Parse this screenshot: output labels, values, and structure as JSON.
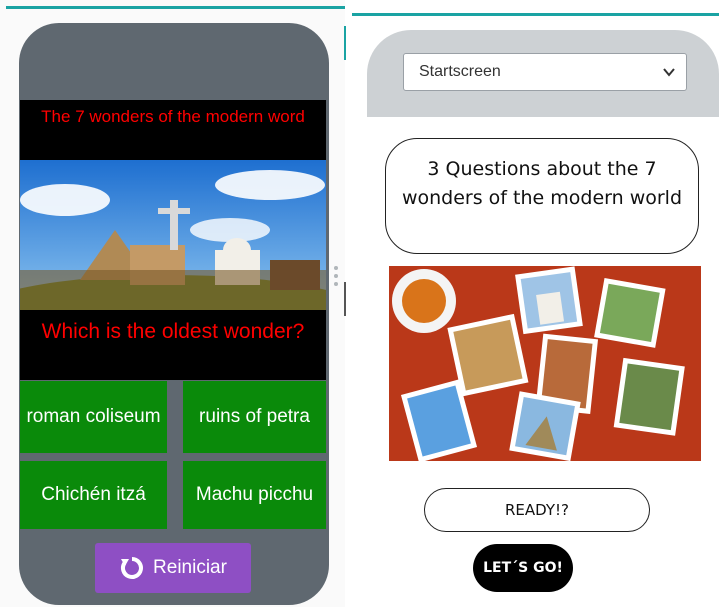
{
  "left_app": {
    "quiz_title": "The 7 wonders of the modern word",
    "hero_image_icon": "wonders-collage-image",
    "question": "Which is the oldest wonder?",
    "answers": [
      "roman coliseum",
      "ruins of petra",
      "Chichén itzá",
      "Machu picchu"
    ],
    "restart_label": "Reiniciar",
    "restart_icon": "refresh-icon",
    "colors": {
      "title_text": "#ff0000",
      "answer_bg": "#0a8a0a",
      "restart_bg": "#8e4fc4",
      "frame": "#5f6870"
    }
  },
  "right_app": {
    "screen_select": {
      "value": "Startscreen",
      "icon": "chevron-down-icon"
    },
    "intro_text": "3 Questions about the 7 wonders of the modern world",
    "collage_image_icon": "postcards-collage-image",
    "ready_label": "READY!?",
    "start_label": "LET´S GO!",
    "colors": {
      "header_bg": "#cdd1d4",
      "accent_line": "#1aa3a3"
    }
  }
}
